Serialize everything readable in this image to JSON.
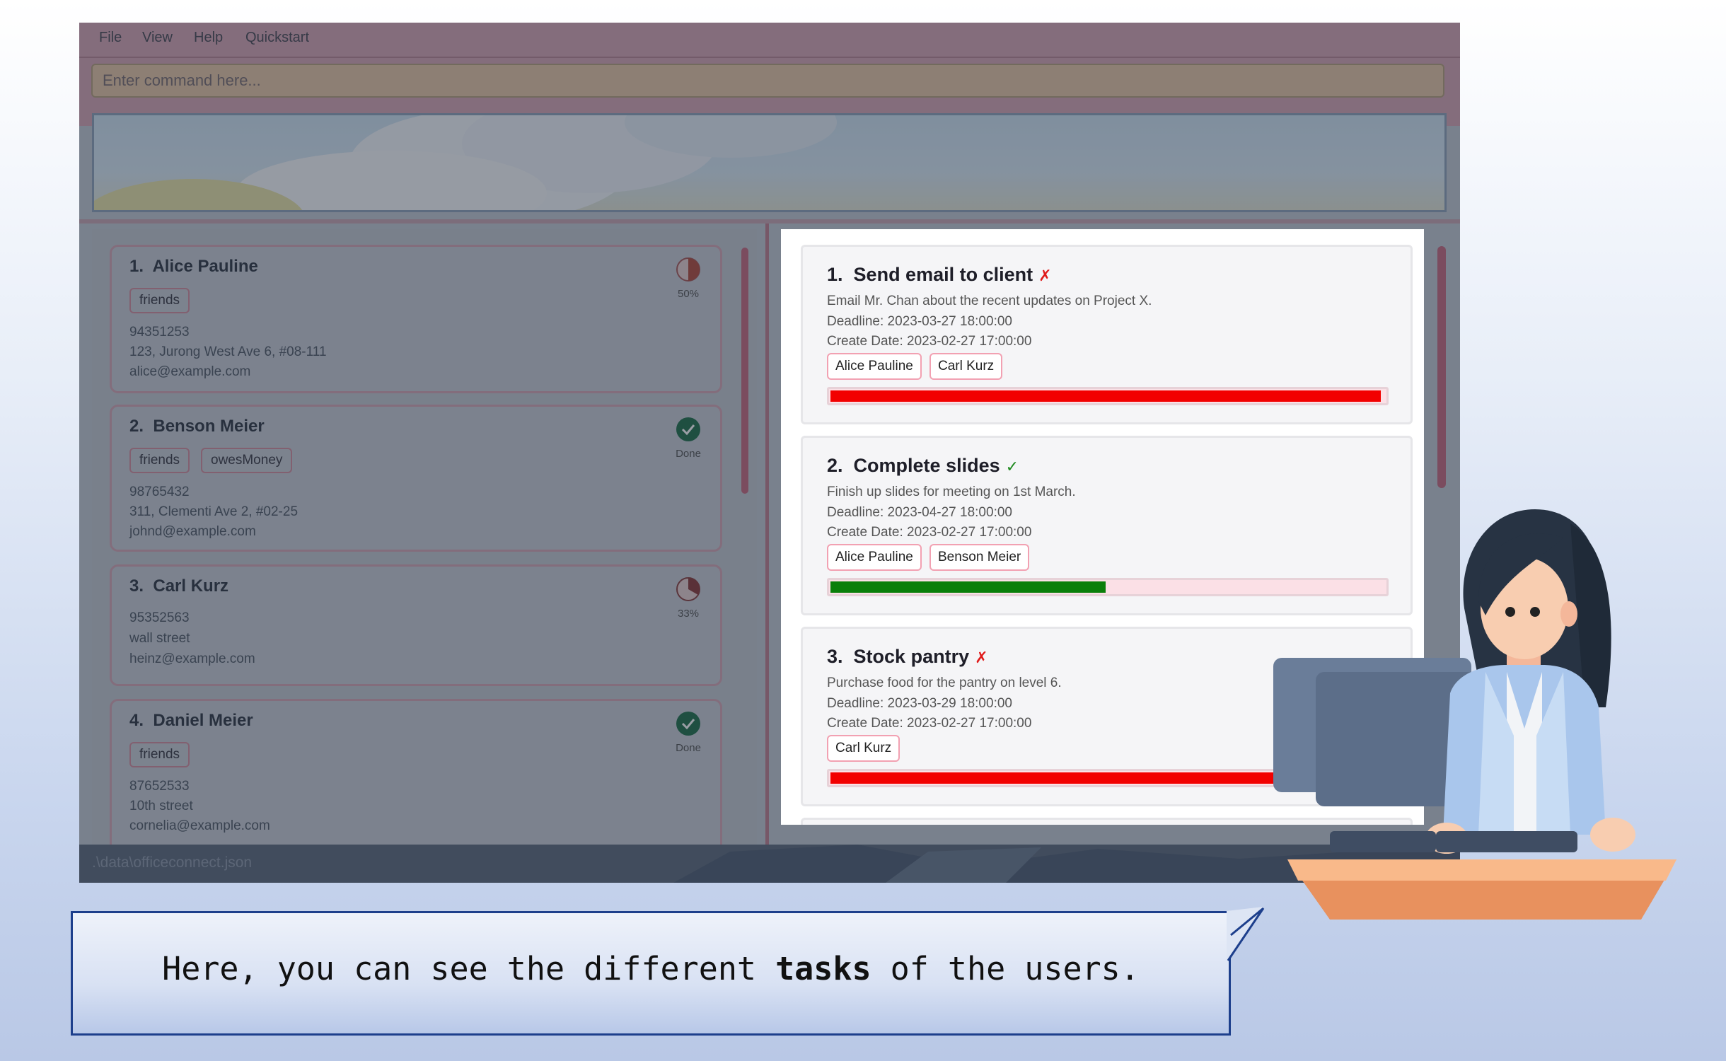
{
  "menu": [
    "File",
    "View",
    "Help",
    "Quickstart"
  ],
  "command": {
    "placeholder": "Enter command here..."
  },
  "persons": [
    {
      "index": "1.",
      "name": "Alice Pauline",
      "tags": [
        "friends"
      ],
      "phone": "94351253",
      "address": "123, Jurong West Ave 6, #08-111",
      "email": "alice@example.com",
      "status": "50%",
      "status_icon": "half-pie-icon",
      "progress": 0.5
    },
    {
      "index": "2.",
      "name": "Benson Meier",
      "tags": [
        "friends",
        "owesMoney"
      ],
      "phone": "98765432",
      "address": "311, Clementi Ave 2, #02-25",
      "email": "johnd@example.com",
      "status": "Done",
      "status_icon": "check-circle-icon",
      "progress": 1.0
    },
    {
      "index": "3.",
      "name": "Carl Kurz",
      "tags": [],
      "phone": "95352563",
      "address": "wall street",
      "email": "heinz@example.com",
      "status": "33%",
      "status_icon": "third-pie-icon",
      "progress": 0.33
    },
    {
      "index": "4.",
      "name": "Daniel Meier",
      "tags": [
        "friends"
      ],
      "phone": "87652533",
      "address": "10th street",
      "email": "cornelia@example.com",
      "status": "Done",
      "status_icon": "check-circle-icon",
      "progress": 1.0
    }
  ],
  "tasks": [
    {
      "index": "1.",
      "title": "Send email to client",
      "mark": "✗",
      "mark_color": "#e01a1a",
      "description": "Email Mr. Chan about the recent updates on Project X.",
      "deadline": "Deadline: 2023-03-27 18:00:00",
      "created": "Create Date: 2023-02-27 17:00:00",
      "assignees": [
        "Alice Pauline",
        "Carl Kurz"
      ],
      "progress": 1.0,
      "bar_color": "#f20000"
    },
    {
      "index": "2.",
      "title": "Complete slides",
      "mark": "✓",
      "mark_color": "#1e8a1e",
      "description": "Finish up slides for meeting on 1st March.",
      "deadline": "Deadline: 2023-04-27 18:00:00",
      "created": "Create Date: 2023-02-27 17:00:00",
      "assignees": [
        "Alice Pauline",
        "Benson Meier"
      ],
      "progress": 0.5,
      "bar_color": "#0a7f0a"
    },
    {
      "index": "3.",
      "title": "Stock pantry",
      "mark": "✗",
      "mark_color": "#e01a1a",
      "description": "Purchase food for the pantry on level 6.",
      "deadline": "Deadline: 2023-03-29 18:00:00",
      "created": "Create Date: 2023-02-27 17:00:00",
      "assignees": [
        "Carl Kurz"
      ],
      "progress": 1.0,
      "bar_color": "#f20000"
    }
  ],
  "status_bar": ".\\data\\officeconnect.json",
  "bubble": {
    "before": "Here, you can see the different ",
    "bold": "tasks",
    "after": " of the users."
  }
}
